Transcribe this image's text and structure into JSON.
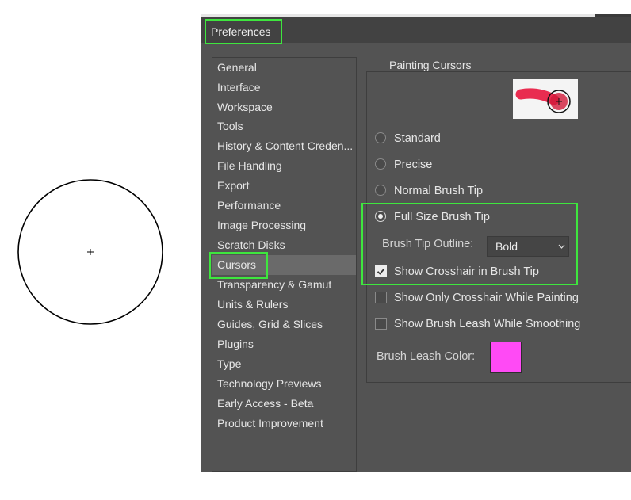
{
  "dialog": {
    "title": "Preferences"
  },
  "sidebar": {
    "items": [
      "General",
      "Interface",
      "Workspace",
      "Tools",
      "History & Content Creden...",
      "File Handling",
      "Export",
      "Performance",
      "Image Processing",
      "Scratch Disks",
      "Cursors",
      "Transparency & Gamut",
      "Units & Rulers",
      "Guides, Grid & Slices",
      "Plugins",
      "Type",
      "Technology Previews",
      "Early Access - Beta",
      "Product Improvement"
    ],
    "selected": "Cursors"
  },
  "painting_cursors": {
    "title": "Painting Cursors",
    "options": [
      {
        "label": "Standard",
        "selected": false
      },
      {
        "label": "Precise",
        "selected": false
      },
      {
        "label": "Normal Brush Tip",
        "selected": false
      },
      {
        "label": "Full Size Brush Tip",
        "selected": true
      }
    ],
    "brush_tip_outline": {
      "label": "Brush Tip Outline:",
      "value": "Bold"
    },
    "checkboxes": [
      {
        "label": "Show Crosshair in Brush Tip",
        "checked": true
      },
      {
        "label": "Show Only Crosshair While Painting",
        "checked": false
      },
      {
        "label": "Show Brush Leash While Smoothing",
        "checked": false
      }
    ],
    "brush_leash_color": {
      "label": "Brush Leash Color:",
      "color": "#ff4af5"
    }
  },
  "colors": {
    "highlight": "#3ee63e",
    "dialog_bg": "#535353",
    "preview_stroke": "#e8163e"
  }
}
